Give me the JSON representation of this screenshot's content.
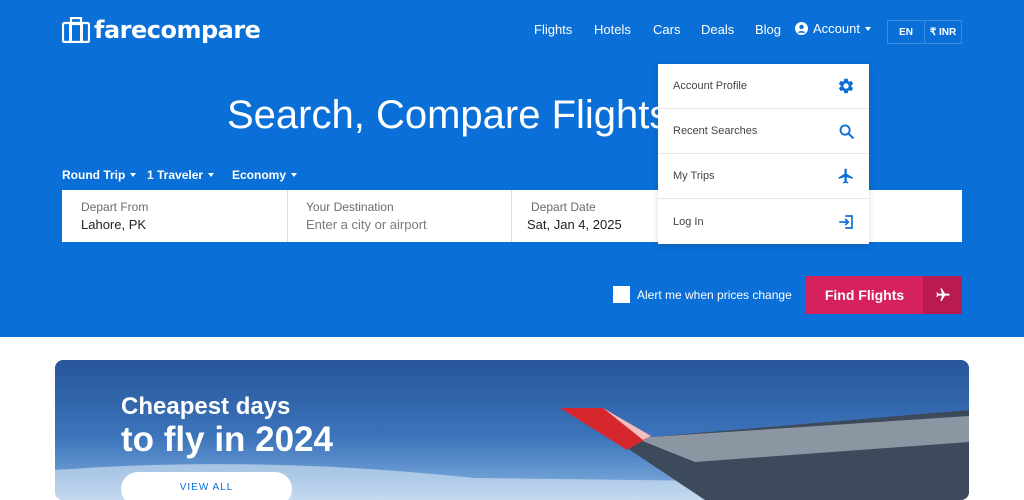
{
  "brand": {
    "name": "farecompare"
  },
  "nav": {
    "items": [
      {
        "label": "Flights"
      },
      {
        "label": "Hotels"
      },
      {
        "label": "Cars"
      },
      {
        "label": "Deals"
      },
      {
        "label": "Blog"
      }
    ],
    "account_label": "Account",
    "lang": "EN",
    "currency": "₹ INR"
  },
  "account_menu": [
    {
      "label": "Account Profile",
      "icon": "gear-icon"
    },
    {
      "label": "Recent Searches",
      "icon": "search-icon"
    },
    {
      "label": "My Trips",
      "icon": "plane-icon"
    },
    {
      "label": "Log In",
      "icon": "login-icon"
    }
  ],
  "hero": {
    "headline": "Search, Compare Flights"
  },
  "search": {
    "trip_type": "Round Trip",
    "travelers": "1 Traveler",
    "cabin": "Economy",
    "fields": [
      {
        "label": "Depart From",
        "value": "Lahore, PK",
        "placeholder": ""
      },
      {
        "label": "Your Destination",
        "value": "",
        "placeholder": "Enter a city or airport"
      },
      {
        "label": "Depart Date",
        "value": "Sat, Jan 4, 2025",
        "placeholder": ""
      }
    ],
    "alert_label": "Alert me when prices change",
    "alert_checked": false,
    "find_label": "Find Flights"
  },
  "banner": {
    "line1": "Cheapest days",
    "line2": "to fly in 2024",
    "button": "VIEW ALL"
  },
  "colors": {
    "primary": "#0a6fd6",
    "accent": "#d5215e",
    "accent_dark": "#b81a51"
  }
}
